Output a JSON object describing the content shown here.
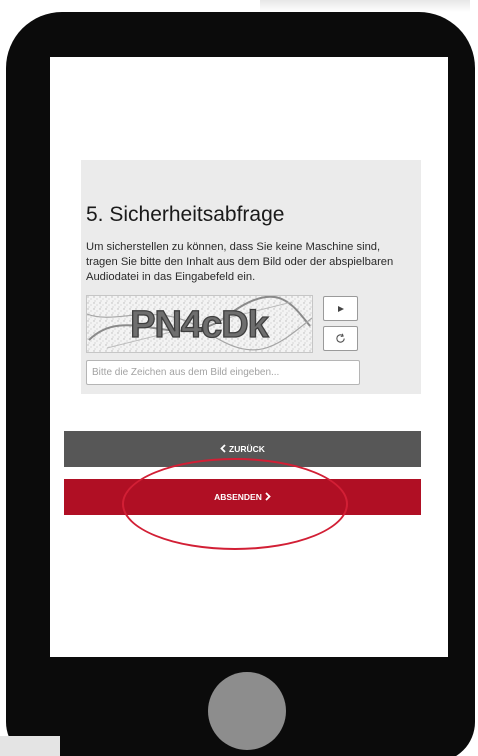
{
  "captcha_section": {
    "title": "5. Sicherheitsabfrage",
    "description": "Um sicherstellen zu können, dass Sie keine Maschine sind, tragen Sie bitte den Inhalt aus dem Bild oder der abspielbaren Audiodatei in das Eingabefeld ein.",
    "captcha_text": "PN4cDk",
    "audio_icon": "play-icon",
    "reload_icon": "reload-icon",
    "input_placeholder": "Bitte die Zeichen aus dem Bild eingeben...",
    "input_value": ""
  },
  "buttons": {
    "back_label": "ZURÜCK",
    "back_icon": "chevron-left-icon",
    "submit_label": "ABSENDEN",
    "submit_icon": "chevron-right-icon"
  },
  "colors": {
    "submit": "#b00f24",
    "back": "#575757",
    "highlight": "#d21f35",
    "phone_frame": "#0b0b0b",
    "home_button": "#8d8d8d"
  }
}
